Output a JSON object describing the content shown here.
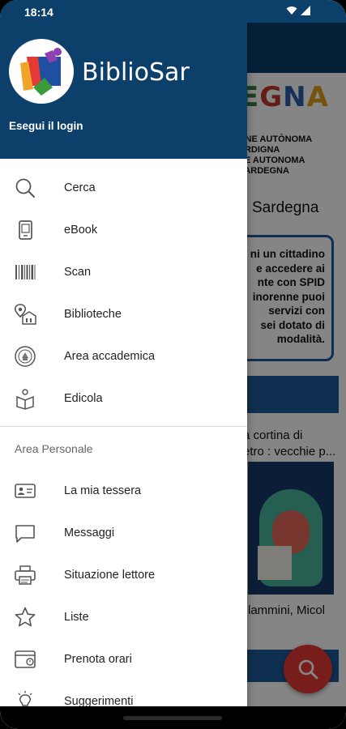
{
  "status_bar": {
    "time": "18:14"
  },
  "drawer": {
    "app_name": "BiblioSar",
    "login_label": "Esegui il login",
    "main_items": [
      {
        "label": "Cerca",
        "icon": "search-icon"
      },
      {
        "label": "eBook",
        "icon": "ebook-icon"
      },
      {
        "label": "Scan",
        "icon": "barcode-icon"
      },
      {
        "label": "Biblioteche",
        "icon": "library-location-icon"
      },
      {
        "label": "Area accademica",
        "icon": "academic-seal-icon"
      },
      {
        "label": "Edicola",
        "icon": "newsstand-icon"
      }
    ],
    "section_title": "Area Personale",
    "personal_items": [
      {
        "label": "La mia tessera",
        "icon": "id-card-icon"
      },
      {
        "label": "Messaggi",
        "icon": "message-icon"
      },
      {
        "label": "Situazione lettore",
        "icon": "printer-icon"
      },
      {
        "label": "Liste",
        "icon": "star-icon"
      },
      {
        "label": "Prenota orari",
        "icon": "calendar-booking-icon"
      },
      {
        "label": "Suggerimenti",
        "icon": "lightbulb-icon"
      }
    ]
  },
  "background_page": {
    "brand_letters": [
      "E",
      "G",
      "N",
      "A"
    ],
    "org_lines": [
      "ONE AUTÒNOMA",
      "ARDIGNA",
      "NE AUTONOMA",
      "SARDEGNA"
    ],
    "region": "Sardegna",
    "notice_lines": [
      "ni un cittadino",
      "e accedere ai",
      "nte con SPID",
      "inorenne puoi",
      "servizi con",
      "sei dotato di",
      "modalità."
    ],
    "book_title_lines": [
      "a cortina di",
      "etro : vecchie p..."
    ],
    "book_author": "lammini, Micol"
  },
  "colors": {
    "header_blue": "#0d3f6b",
    "fab_red": "#e53935",
    "accent_blue": "#1d5a9a"
  }
}
